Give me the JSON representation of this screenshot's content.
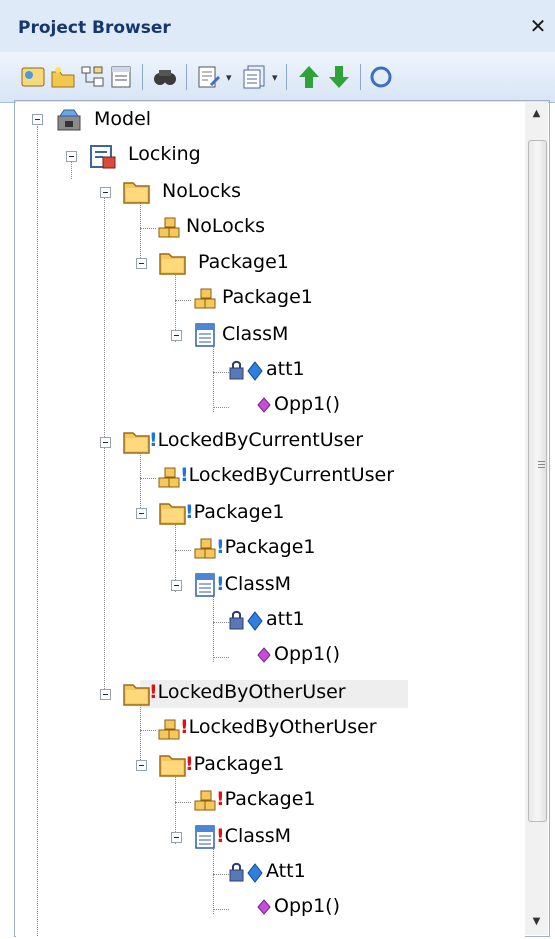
{
  "window": {
    "title": "Project Browser",
    "close_symbol": "✕"
  },
  "toolbar": {
    "buttons": [
      "new-model-icon",
      "new-package-icon",
      "new-diagram-icon",
      "new-element-icon",
      "find-icon",
      "properties-icon",
      "layout-icon",
      "move-up-icon",
      "move-down-icon",
      "more-icon"
    ]
  },
  "colors": {
    "title_bg": "#dfeaf8",
    "title_text": "#15376f",
    "bang_current_user": "#1976d8",
    "bang_other_user": "#e01010"
  },
  "tree": {
    "model": "Model",
    "locking": "Locking",
    "nolocks": "NoLocks",
    "nolocks_elem": "NoLocks",
    "pkg1_a": "Package1",
    "pkg1_a_elem": "Package1",
    "classm_a": "ClassM",
    "att1_a": "att1",
    "opp1_a": "Opp1()",
    "current_user": "LockedByCurrentUser",
    "current_user_elem": "LockedByCurrentUser",
    "pkg1_b": "Package1",
    "pkg1_b_elem": "Package1",
    "classm_b": "ClassM",
    "att1_b": "att1",
    "opp1_b": "Opp1()",
    "other_user": "LockedByOtherUser",
    "other_user_elem": "LockedByOtherUser",
    "pkg1_c": "Package1",
    "pkg1_c_elem": "Package1",
    "classm_c": "ClassM",
    "att1_c": "Att1",
    "opp1_c": "Opp1()"
  },
  "markers": {
    "bang": "!"
  },
  "scrollbar": {
    "up_arrow": "▲",
    "down_arrow": "▼"
  }
}
